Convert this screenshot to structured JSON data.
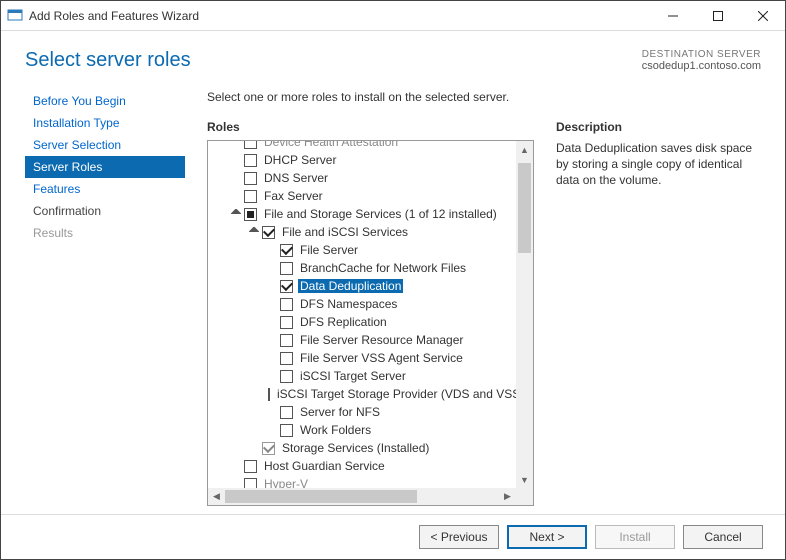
{
  "window": {
    "title": "Add Roles and Features Wizard"
  },
  "header": {
    "heading": "Select server roles",
    "dest_label": "DESTINATION SERVER",
    "dest_value": "csodedup1.contoso.com"
  },
  "steps": [
    {
      "label": "Before You Begin",
      "state": "link"
    },
    {
      "label": "Installation Type",
      "state": "link"
    },
    {
      "label": "Server Selection",
      "state": "link"
    },
    {
      "label": "Server Roles",
      "state": "sel"
    },
    {
      "label": "Features",
      "state": "link"
    },
    {
      "label": "Confirmation",
      "state": ""
    },
    {
      "label": "Results",
      "state": "dis"
    }
  ],
  "intro": "Select one or more roles to install on the selected server.",
  "roles_label": "Roles",
  "desc_label": "Description",
  "desc_text": "Data Deduplication saves disk space by storing a single copy of identical data on the volume.",
  "roles": [
    {
      "indent": 1,
      "box": "unchecked",
      "label": "Device Health Attestation",
      "cut": true,
      "expander": "none"
    },
    {
      "indent": 1,
      "box": "unchecked",
      "label": "DHCP Server",
      "expander": "none"
    },
    {
      "indent": 1,
      "box": "unchecked",
      "label": "DNS Server",
      "expander": "none"
    },
    {
      "indent": 1,
      "box": "unchecked",
      "label": "Fax Server",
      "expander": "none"
    },
    {
      "indent": 1,
      "box": "mixed",
      "label": "File and Storage Services (1 of 12 installed)",
      "expander": "open"
    },
    {
      "indent": 2,
      "box": "checked",
      "label": "File and iSCSI Services",
      "expander": "open"
    },
    {
      "indent": 3,
      "box": "checked",
      "label": "File Server",
      "expander": "none"
    },
    {
      "indent": 3,
      "box": "unchecked",
      "label": "BranchCache for Network Files",
      "expander": "none"
    },
    {
      "indent": 3,
      "box": "checked",
      "label": "Data Deduplication",
      "selected": true,
      "expander": "none"
    },
    {
      "indent": 3,
      "box": "unchecked",
      "label": "DFS Namespaces",
      "expander": "none"
    },
    {
      "indent": 3,
      "box": "unchecked",
      "label": "DFS Replication",
      "expander": "none"
    },
    {
      "indent": 3,
      "box": "unchecked",
      "label": "File Server Resource Manager",
      "expander": "none"
    },
    {
      "indent": 3,
      "box": "unchecked",
      "label": "File Server VSS Agent Service",
      "expander": "none"
    },
    {
      "indent": 3,
      "box": "unchecked",
      "label": "iSCSI Target Server",
      "expander": "none"
    },
    {
      "indent": 3,
      "box": "unchecked",
      "label": "iSCSI Target Storage Provider (VDS and VSS hardware providers)",
      "expander": "none"
    },
    {
      "indent": 3,
      "box": "unchecked",
      "label": "Server for NFS",
      "expander": "none"
    },
    {
      "indent": 3,
      "box": "unchecked",
      "label": "Work Folders",
      "expander": "none"
    },
    {
      "indent": 2,
      "box": "checked-disabled",
      "label": "Storage Services (Installed)",
      "expander": "none"
    },
    {
      "indent": 1,
      "box": "unchecked",
      "label": "Host Guardian Service",
      "expander": "none"
    },
    {
      "indent": 1,
      "box": "unchecked",
      "label": "Hyper-V",
      "cut": true,
      "expander": "none"
    }
  ],
  "footer": {
    "previous": "< Previous",
    "next": "Next >",
    "install": "Install",
    "cancel": "Cancel"
  }
}
